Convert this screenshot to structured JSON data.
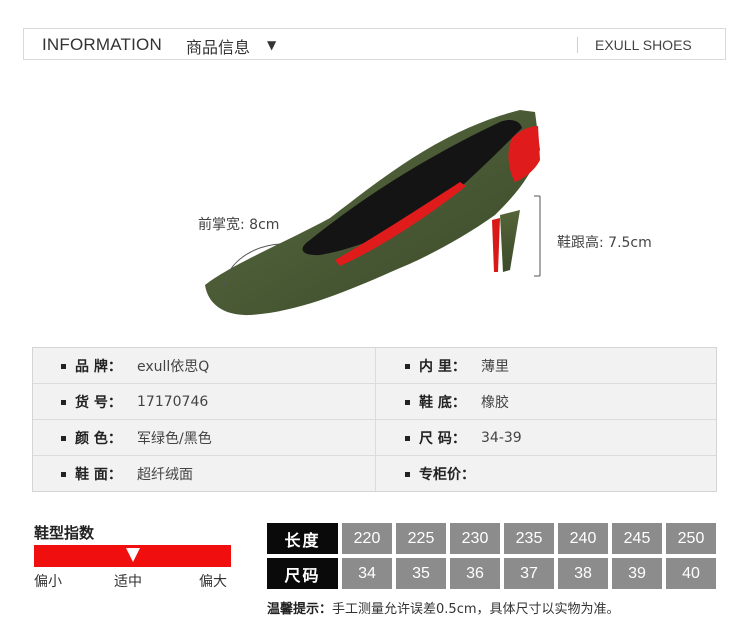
{
  "header": {
    "title_en": "INFORMATION",
    "title_cn": "商品信息",
    "dropdown_glyph": "▼",
    "brand": "EXULL SHOES"
  },
  "product_image": {
    "description_icon": "shoe-image",
    "colors": {
      "suede": "#4a5a35",
      "lining": "#1a1a1a",
      "heel_red": "#e01b1b"
    },
    "forefoot_label": "前掌宽: 8cm",
    "heel_label": "鞋跟高: 7.5cm"
  },
  "spec": {
    "rows": [
      {
        "left_key": "品 牌：",
        "left_value": "exull依思Q",
        "right_key": "内 里：",
        "right_value": "薄里"
      },
      {
        "left_key": "货 号：",
        "left_value": "17170746",
        "right_key": "鞋 底：",
        "right_value": "橡胶"
      },
      {
        "left_key": "颜 色：",
        "left_value": "军绿色/黑色",
        "right_key": "尺 码：",
        "right_value": "34-39"
      },
      {
        "left_key": "鞋 面：",
        "left_value": "超纤绒面",
        "right_key": "专柜价：",
        "right_value": ""
      }
    ]
  },
  "fit": {
    "title": "鞋型指数",
    "labels": [
      "偏小",
      "适中",
      "偏大"
    ],
    "bar_color": "#f10e0e",
    "position": 0.5
  },
  "size_chart": {
    "length_label": "长度",
    "size_label": "尺码",
    "lengths": [
      "220",
      "225",
      "230",
      "235",
      "240",
      "245",
      "250"
    ],
    "sizes": [
      "34",
      "35",
      "36",
      "37",
      "38",
      "39",
      "40"
    ]
  },
  "note": {
    "prefix": "温馨提示：",
    "text": "手工测量允许误差0.5cm，具体尺寸以实物为准。"
  }
}
